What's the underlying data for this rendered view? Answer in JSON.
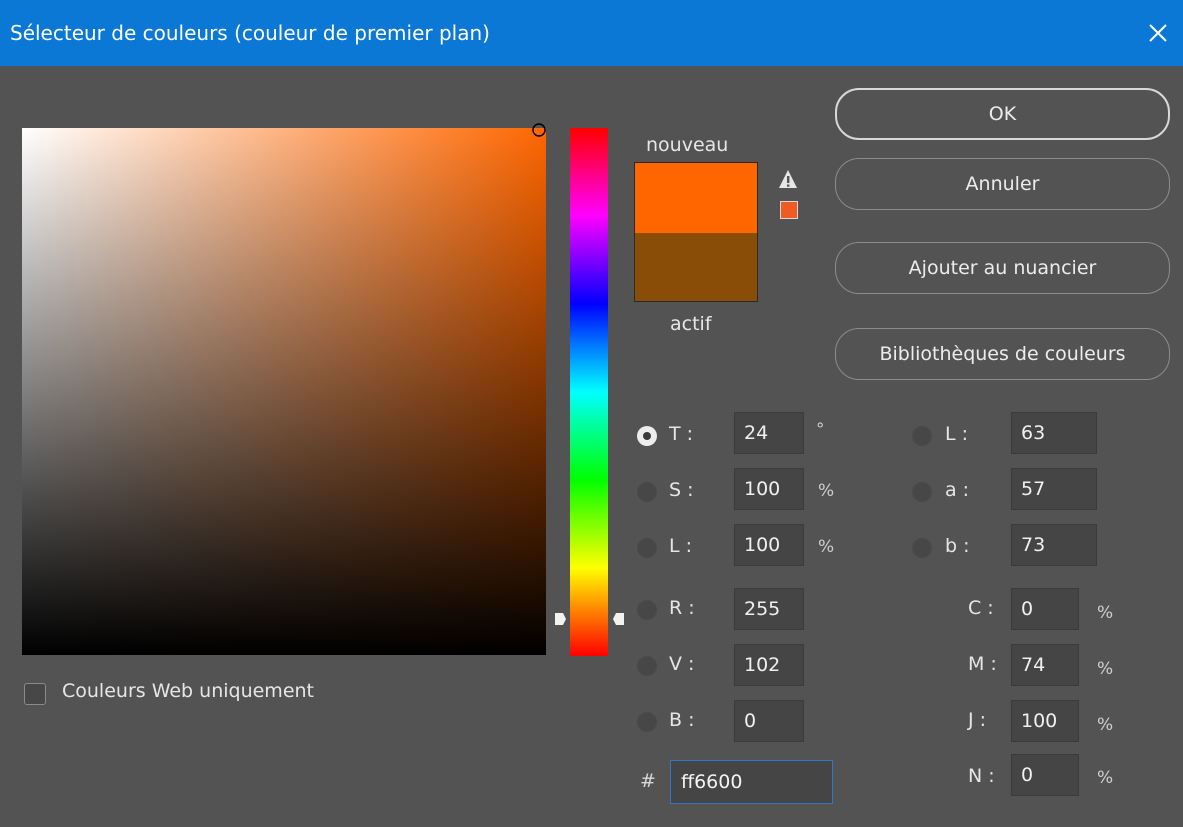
{
  "window": {
    "title": "Sélecteur de couleurs (couleur de premier plan)"
  },
  "colors": {
    "new": "#ff6600",
    "current": "#8a4d07",
    "gamut": "#f05a24",
    "field_hue": "#ff6600",
    "accent": "#0a78d4"
  },
  "preview": {
    "new_label": "nouveau",
    "current_label": "actif"
  },
  "buttons": {
    "ok": "OK",
    "cancel": "Annuler",
    "add_swatch": "Ajouter au nuancier",
    "libraries": "Bibliothèques de couleurs"
  },
  "hsb": {
    "h": {
      "label": "T :",
      "value": "24",
      "unit": "°"
    },
    "s": {
      "label": "S :",
      "value": "100",
      "unit": "%"
    },
    "b": {
      "label": "L :",
      "value": "100",
      "unit": "%"
    }
  },
  "rgb": {
    "r": {
      "label": "R :",
      "value": "255"
    },
    "g": {
      "label": "V :",
      "value": "102"
    },
    "b": {
      "label": "B :",
      "value": "0"
    }
  },
  "lab": {
    "l": {
      "label": "L :",
      "value": "63"
    },
    "a": {
      "label": "a :",
      "value": "57"
    },
    "b": {
      "label": "b :",
      "value": "73"
    }
  },
  "cmyk": {
    "c": {
      "label": "C :",
      "value": "0",
      "unit": "%"
    },
    "m": {
      "label": "M :",
      "value": "74",
      "unit": "%"
    },
    "y": {
      "label": "J :",
      "value": "100",
      "unit": "%"
    },
    "k": {
      "label": "N :",
      "value": "0",
      "unit": "%"
    }
  },
  "hex": {
    "label": "#",
    "value": "ff6600"
  },
  "web_only": {
    "label": "Couleurs Web uniquement",
    "checked": false
  },
  "icons": {
    "close": "close-icon",
    "warning": "gamut-warning-icon",
    "marker": "color-field-marker-icon",
    "slider": "hue-slider-arrow-icon"
  }
}
